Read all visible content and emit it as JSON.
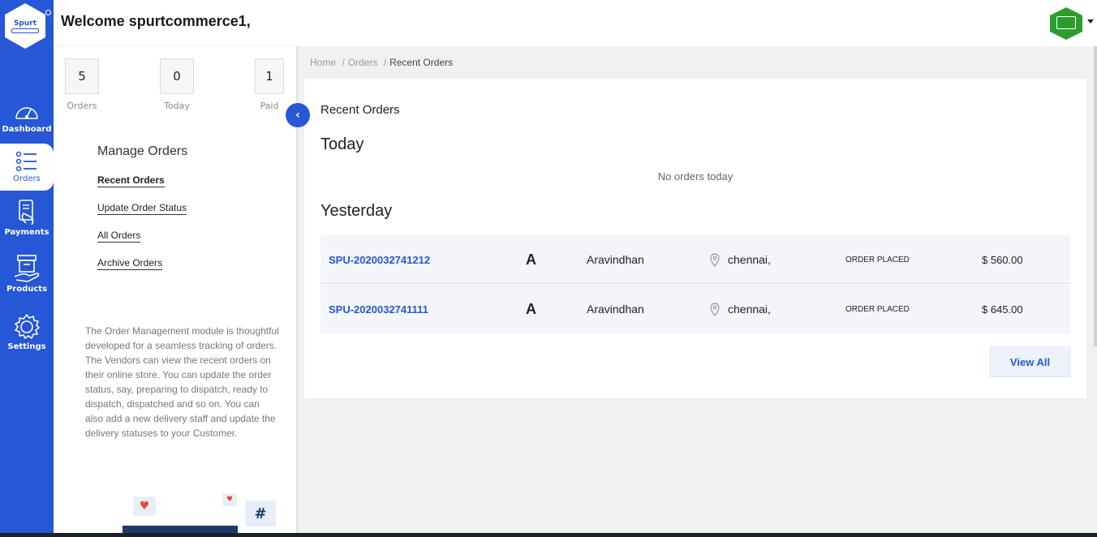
{
  "app": {
    "welcome": "Welcome spurtcommerce1,",
    "logo_text": "Spurt"
  },
  "colors": {
    "primary": "#2557d6",
    "avatar": "#2c9d2c"
  },
  "rail": {
    "items": [
      {
        "label": "Dashboard",
        "icon": "dashboard-icon"
      },
      {
        "label": "Orders",
        "icon": "orders-list-icon",
        "active": true
      },
      {
        "label": "Payments",
        "icon": "payments-icon"
      },
      {
        "label": "Products",
        "icon": "products-icon"
      },
      {
        "label": "Settings",
        "icon": "settings-gear-icon"
      }
    ]
  },
  "stats": [
    {
      "value": "5",
      "label": "Orders"
    },
    {
      "value": "0",
      "label": "Today"
    },
    {
      "value": "1",
      "label": "Paid"
    }
  ],
  "panel": {
    "heading": "Manage Orders",
    "links": [
      "Recent Orders",
      "Update Order Status",
      "All Orders",
      "Archive Orders"
    ],
    "description": "The Order Management module is thoughtful developed for a seamless tracking of orders. The Vendors can view the recent orders on their online store. You can update the order status, say, preparing to dispatch, ready to dispatch, dispatched and so on. You can also add a new delivery staff and update the delivery statuses to your Customer."
  },
  "breadcrumb": {
    "home": "Home",
    "orders": "Orders",
    "current": "Recent Orders"
  },
  "main": {
    "title": "Recent Orders",
    "today_heading": "Today",
    "today_empty": "No orders today",
    "yesterday_heading": "Yesterday",
    "orders": [
      {
        "id": "SPU-2020032741212",
        "initial": "A",
        "customer": "Aravindhan",
        "city": "chennai,",
        "status": "ORDER PLACED",
        "amount": "$ 560.00"
      },
      {
        "id": "SPU-2020032741111",
        "initial": "A",
        "customer": "Aravindhan",
        "city": "chennai,",
        "status": "ORDER PLACED",
        "amount": "$ 645.00"
      }
    ],
    "view_all": "View All"
  }
}
